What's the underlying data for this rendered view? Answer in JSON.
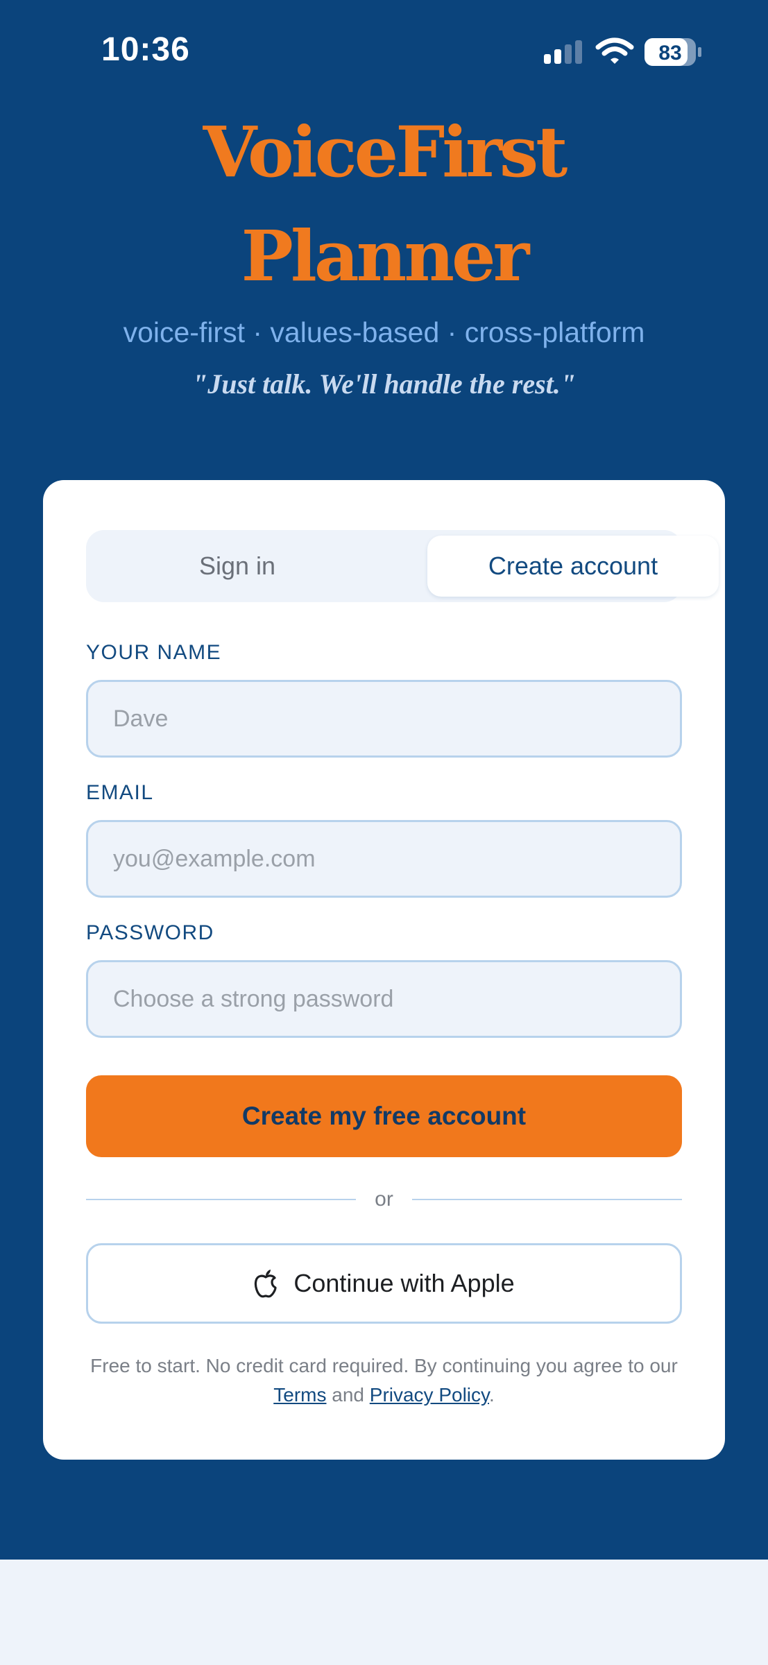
{
  "status_bar": {
    "time": "10:36",
    "battery_level": "83",
    "signal_icon": "cellular-signal-icon",
    "wifi_icon": "wifi-icon",
    "battery_icon": "battery-icon"
  },
  "header": {
    "title_line1": "VoiceFirst",
    "title_line2": "Planner",
    "tagline": "voice-first · values-based · cross-platform",
    "motto": "\"Just talk. We'll handle the rest.\""
  },
  "auth": {
    "tabs": [
      {
        "label": "Sign in",
        "selected": false
      },
      {
        "label": "Create account",
        "selected": true
      }
    ],
    "fields": {
      "name": {
        "label": "YOUR NAME",
        "placeholder": "Dave",
        "value": ""
      },
      "email": {
        "label": "EMAIL",
        "placeholder": "you@example.com",
        "value": ""
      },
      "password": {
        "label": "PASSWORD",
        "placeholder": "Choose a strong password",
        "value": ""
      }
    },
    "submit_label": "Create my free account",
    "divider_text": "or",
    "apple_label": "Continue with Apple",
    "apple_icon": "apple-logo-icon",
    "legal": {
      "prefix": "Free to start. No credit card required. By continuing you agree to our",
      "terms_link": "Terms",
      "and_text": "and",
      "privacy_link": "Privacy Policy",
      "suffix": "."
    }
  },
  "colors": {
    "background_navy": "#0b447c",
    "accent_orange": "#f07a1f",
    "field_background": "#eef3fa",
    "field_border": "#b7d2ec",
    "label_blue": "#124a80"
  }
}
